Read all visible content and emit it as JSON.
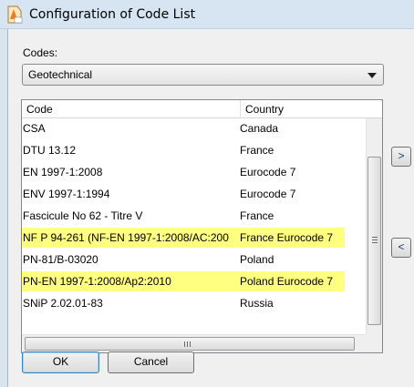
{
  "window": {
    "title": "Configuration of Code List"
  },
  "codes": {
    "label": "Codes:",
    "selected": "Geotechnical"
  },
  "table": {
    "columns": [
      "Code",
      "Country"
    ],
    "rows": [
      {
        "code": "CSA",
        "country": "Canada",
        "highlighted": false
      },
      {
        "code": "DTU 13.12",
        "country": "France",
        "highlighted": false
      },
      {
        "code": "EN 1997-1:2008",
        "country": "Eurocode 7",
        "highlighted": false
      },
      {
        "code": "ENV 1997-1:1994",
        "country": "Eurocode 7",
        "highlighted": false
      },
      {
        "code": "Fascicule No 62 - Titre V",
        "country": "France",
        "highlighted": false
      },
      {
        "code": "NF P 94-261 (NF-EN 1997-1:2008/AC:200",
        "country": "France Eurocode 7",
        "highlighted": true
      },
      {
        "code": "PN-81/B-03020",
        "country": "Poland",
        "highlighted": false
      },
      {
        "code": "PN-EN 1997-1:2008/Ap2:2010",
        "country": "Poland Eurocode 7",
        "highlighted": true
      },
      {
        "code": "SNiP 2.02.01-83",
        "country": "Russia",
        "highlighted": false
      }
    ],
    "highlight_color": "#ffff80"
  },
  "side_buttons": {
    "add_label": ">",
    "remove_label": "<"
  },
  "buttons": {
    "ok": "OK",
    "cancel": "Cancel"
  },
  "icons": {
    "app": "geo5-app-icon"
  }
}
